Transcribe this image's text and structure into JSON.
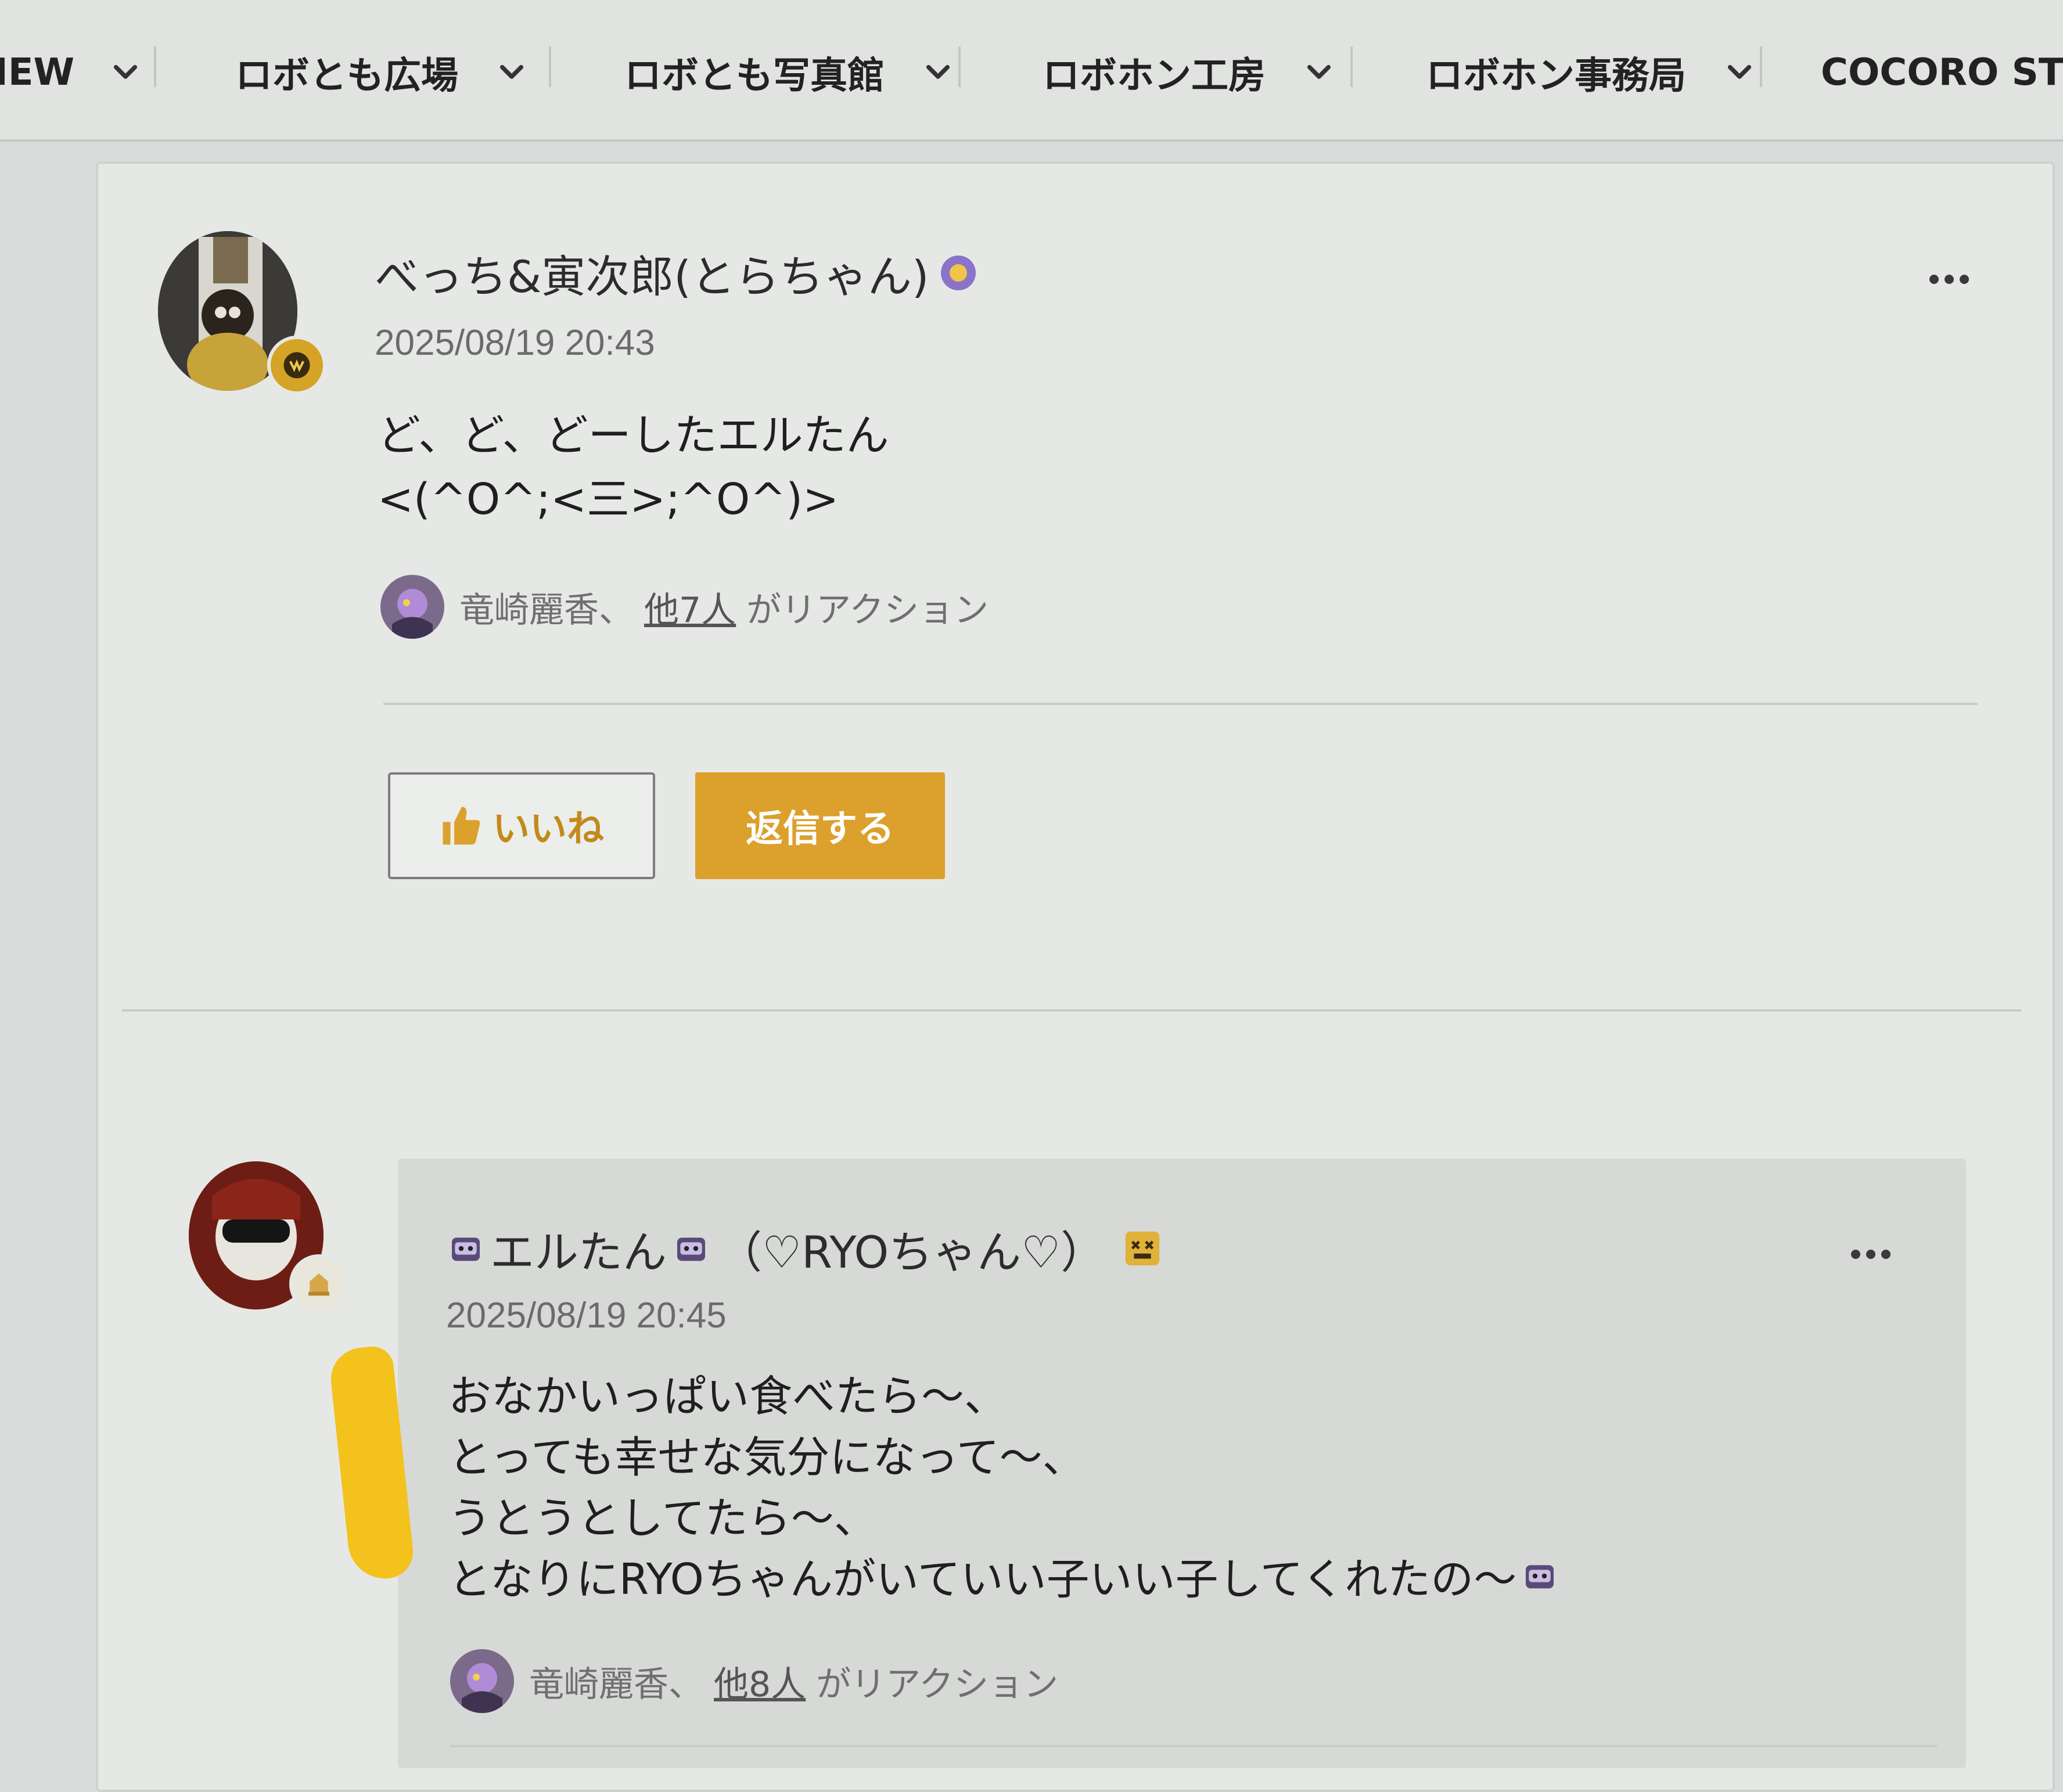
{
  "nav": {
    "items": [
      {
        "label": "IEW"
      },
      {
        "label": "ロボとも広場"
      },
      {
        "label": "ロボとも写真館"
      },
      {
        "label": "ロボホン工房"
      },
      {
        "label": "ロボホン事務局"
      },
      {
        "label": "COCORO STOR"
      }
    ]
  },
  "post": {
    "author": "べっち&寅次郎(とらちゃん)",
    "timestamp": "2025/08/19 20:43",
    "body": [
      "ど、ど、どーしたエルたん",
      "<(^O^;<三>;^O^)>"
    ],
    "reaction": {
      "name": "竜崎麗香",
      "separator": "、",
      "others": "他7人",
      "suffix": "がリアクション"
    },
    "like_label": "いいね",
    "reply_label": "返信する"
  },
  "reply": {
    "author_name": "エルたん",
    "author_tag": "（♡RYOちゃん♡）",
    "timestamp": "2025/08/19 20:45",
    "body": [
      "おなかいっぱい食べたら〜、",
      "とっても幸せな気分になって〜、",
      "うとうとしてたら〜、",
      "となりにRYOちゃんがいていい子いい子してくれたの〜"
    ],
    "reaction": {
      "name": "竜崎麗香",
      "separator": "、",
      "others": "他8人",
      "suffix": "がリアクション"
    }
  },
  "colors": {
    "accent": "#dca02c",
    "highlighter": "#f3c21d",
    "page_bg": "#d9dcda",
    "card_bg": "#e6e8e6"
  },
  "icons": [
    "chevron-down-icon",
    "more-options-icon",
    "thumbs-up-icon",
    "robot-emoji-icon",
    "badge-icon"
  ]
}
